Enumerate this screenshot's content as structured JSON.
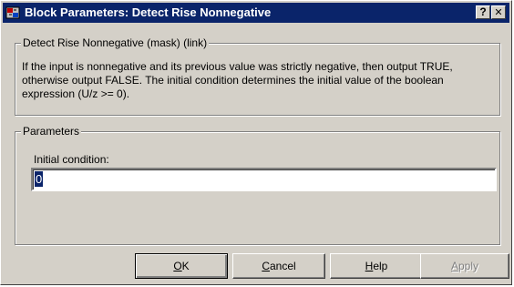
{
  "window": {
    "title": "Block Parameters: Detect Rise Nonnegative",
    "help_btn": "?",
    "close_btn": "✕"
  },
  "description_group": {
    "title": "Detect Rise Nonnegative (mask) (link)",
    "text": "If the input is nonnegative and its previous value was strictly negative, then output TRUE, otherwise output FALSE.  The initial condition determines the initial value of the boolean expression (U/z >= 0)."
  },
  "parameters_group": {
    "title": "Parameters",
    "initial_condition_label": "Initial condition:",
    "initial_condition_value": "0"
  },
  "buttons": {
    "ok_mnemonic": "O",
    "ok_rest": "K",
    "cancel_mnemonic": "C",
    "cancel_rest": "ancel",
    "help_mnemonic": "H",
    "help_rest": "elp",
    "apply_mnemonic": "A",
    "apply_rest": "pply"
  },
  "colors": {
    "titlebar": "#0a246a",
    "face": "#d4d0c8",
    "selection": "#0a246a"
  }
}
